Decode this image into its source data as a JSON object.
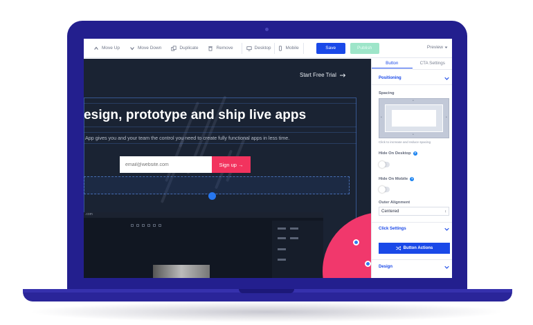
{
  "toolbar": {
    "move_up": "Move Up",
    "move_down": "Move Down",
    "duplicate": "Duplicate",
    "remove": "Remove",
    "desktop": "Desktop",
    "mobile": "Mobile",
    "save": "Save",
    "publish": "Publish",
    "preview": "Preview"
  },
  "canvas": {
    "cta_link": "Start Free Trial",
    "headline": "esign, prototype and ship live apps",
    "subtext": "App gives you and your team the control you need to create fully functional apps in less time.",
    "email_placeholder": "email@website.com",
    "signup_label": "Sign up",
    "app_url": ".com"
  },
  "panel": {
    "tab_button": "Button",
    "tab_cta": "CTA Settings",
    "positioning": "Positioning",
    "spacing": "Spacing",
    "spacing_hint": "Click to increase and reduce spacing",
    "hide_desktop": "Hide On Desktop",
    "hide_mobile": "Hide On Mobile",
    "outer_alignment": "Outer Alignment",
    "alignment_value": "Centered",
    "click_settings": "Click Settings",
    "button_actions": "Button Actions",
    "design": "Design"
  },
  "colors": {
    "laptop_frame": "#231f8e",
    "primary": "#1a49e8",
    "publish": "#9ee5c9",
    "signup": "#f2335e",
    "canvas_bg": "#1a2333"
  }
}
